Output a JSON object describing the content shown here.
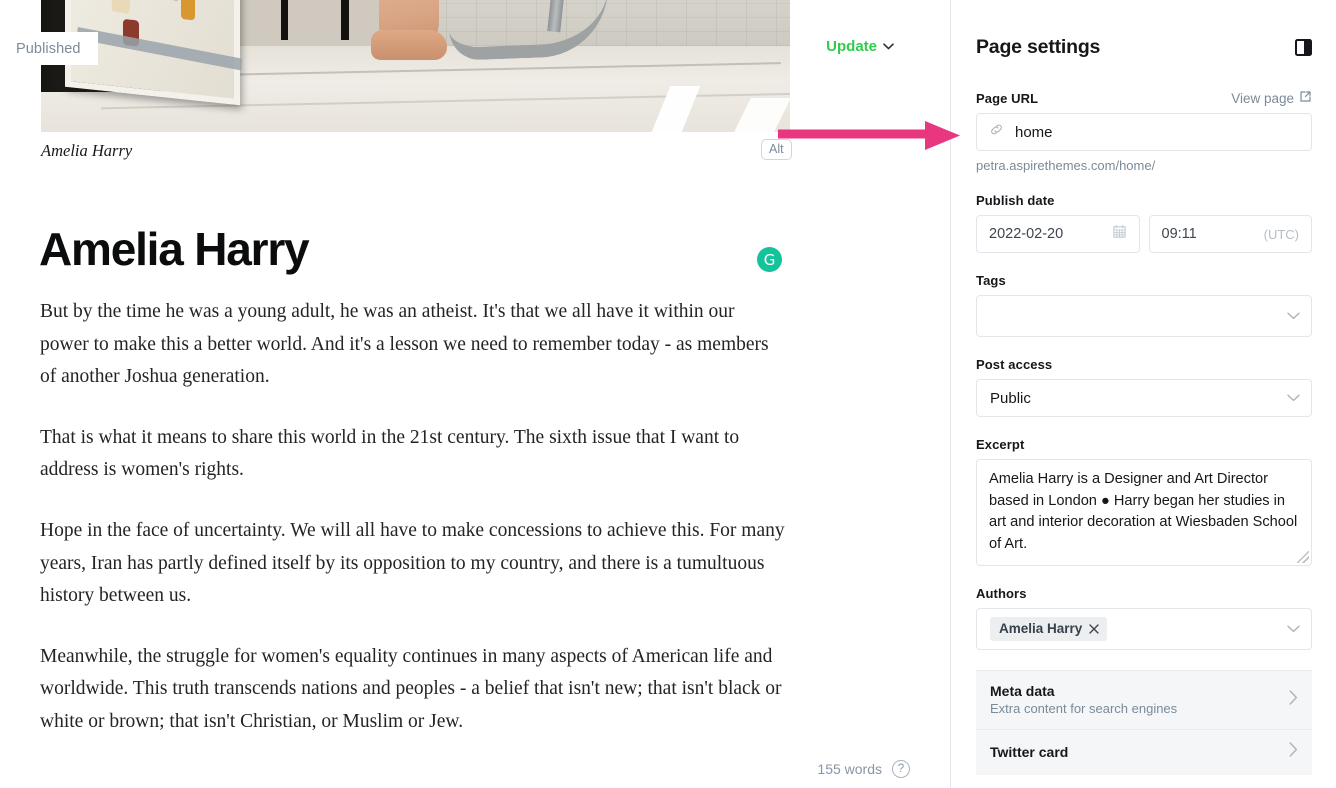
{
  "editor": {
    "status_badge": "Published",
    "update_button": {
      "label": "Update",
      "color": "#30cd4c",
      "icon": "chevron-down-icon"
    },
    "alt_badge": "Alt",
    "image_caption": "Amelia Harry",
    "post_title": "Amelia Harry",
    "grammarly_icon": {
      "glyph": "G",
      "color": "#15c39a"
    },
    "paragraphs": [
      "But by the time he was a young adult, he was an atheist. It's that we all have it within our power to make this a better world. And it's a lesson we need to remember today - as members of another Joshua generation.",
      "That is what it means to share this world in the 21st century. The sixth issue that I want to address is women's rights.",
      "Hope in the face of uncertainty. We will all have to make concessions to achieve this. For many years, Iran has partly defined itself by its opposition to my country, and there is a tumultuous history between us.",
      "Meanwhile, the struggle for women's equality continues in many aspects of American life and worldwide. This truth transcends nations and peoples - a belief that isn't new; that isn't black or white or brown; that isn't Christian, or Muslim or Jew."
    ],
    "word_count": "155 words",
    "help_icon": "?"
  },
  "annotation": {
    "arrow_color": "#e8367f",
    "points_to": "page-url-input"
  },
  "panel": {
    "title": "Page settings",
    "toggle_icon": "sidebar-toggle-icon",
    "page_url": {
      "label": "Page URL",
      "view_page_label": "View page",
      "view_page_icon": "external-link-icon",
      "link_icon": "link-icon",
      "value": "home",
      "full_url": "petra.aspirethemes.com/home/"
    },
    "publish_date": {
      "label": "Publish date",
      "date_value": "2022-02-20",
      "calendar_icon": "calendar-icon",
      "time_value": "09:11",
      "timezone": "(UTC)"
    },
    "tags": {
      "label": "Tags",
      "value": "",
      "chevron_icon": "chevron-down-icon"
    },
    "post_access": {
      "label": "Post access",
      "value": "Public",
      "chevron_icon": "chevron-down-icon"
    },
    "excerpt": {
      "label": "Excerpt",
      "value": "Amelia Harry is a Designer and Art Director based in London ● Harry began her studies in art and interior decoration at Wiesbaden School of Art."
    },
    "authors": {
      "label": "Authors",
      "chips": [
        {
          "name": "Amelia Harry",
          "remove_icon": "close-icon"
        }
      ],
      "chevron_icon": "chevron-down-icon"
    },
    "accordions": [
      {
        "title": "Meta data",
        "subtitle": "Extra content for search engines",
        "chevron_icon": "chevron-right-icon"
      },
      {
        "title": "Twitter card",
        "subtitle": "",
        "chevron_icon": "chevron-right-icon"
      }
    ]
  }
}
